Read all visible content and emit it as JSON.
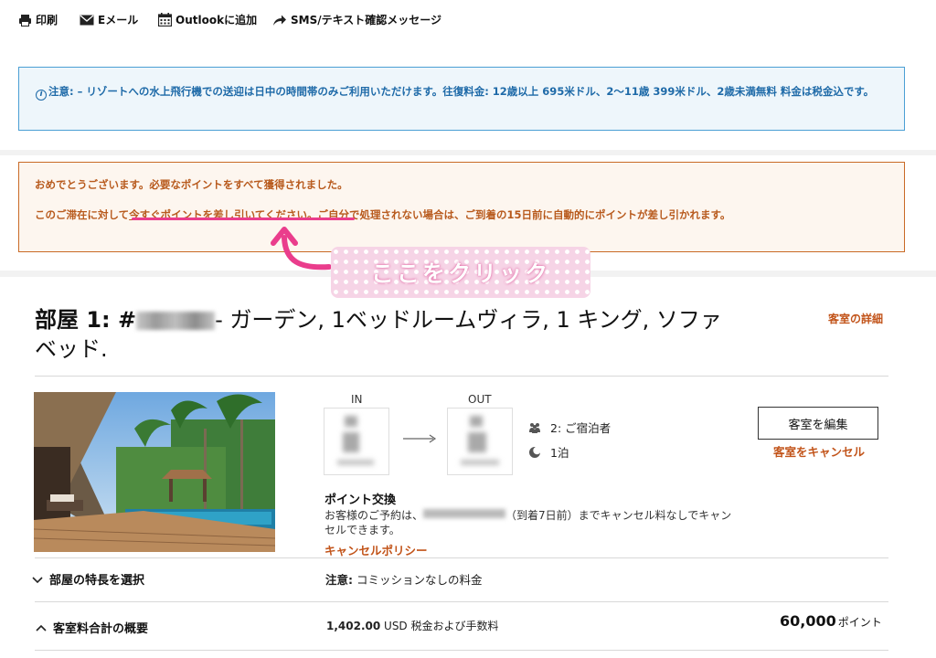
{
  "toolbar": {
    "print": "印刷",
    "email": "Eメール",
    "outlook": "Outlookに追加",
    "sms": "SMS/テキスト確認メッセージ"
  },
  "info": {
    "text": "注意: – リゾートへの水上飛行機での送迎は日中の時間帯のみご利用いただけます。往復料金: 12歳以上 695米ドル、2〜11歳 399米ドル、2歳未満無料 料金は税金込です。"
  },
  "points_notice": {
    "line1": "おめでとうございます。必要なポイントをすべて獲得されました。",
    "line2_prefix": "このご滞在に対して",
    "link": "今すぐポイントを差し引いてください",
    "line2_suffix": "。ご自分で処理されない場合は、ご到着の15日前に自動的にポイントが差し引かれます。"
  },
  "annotation": {
    "callout": "ここをクリック",
    "accent": "#ea3d8c"
  },
  "room": {
    "title_prefix": "部屋 1: #",
    "title_suffix": "- ガーデン, 1ベッドルームヴィラ, 1 キング, ソファベッド.",
    "detail_link": "客室の詳細",
    "in_label": "IN",
    "out_label": "OUT",
    "guests": "2: ご宿泊者",
    "nights": "1泊",
    "edit_button": "客室を編集",
    "cancel_link": "客室をキャンセル",
    "exchange_title": "ポイント交換",
    "exchange_text_prefix": "お客様のご予約は、",
    "exchange_text_suffix": "（到着7日前）までキャンセル料なしでキャンセルできます。",
    "cancel_policy": "キャンセルポリシー"
  },
  "features": {
    "label": "部屋の特長を選択",
    "note_label": "注意:",
    "note_text": " コミッションなしの料金"
  },
  "summary": {
    "label": "客室料合計の概要",
    "price_amount": "1,402.00",
    "price_text": " USD 税金および手数料",
    "points_amount": "60,000",
    "points_unit": "ポイント"
  },
  "colors": {
    "link_orange": "#c2541a",
    "info_blue": "#1e6aa8",
    "notice_orange": "#b85a1d"
  }
}
